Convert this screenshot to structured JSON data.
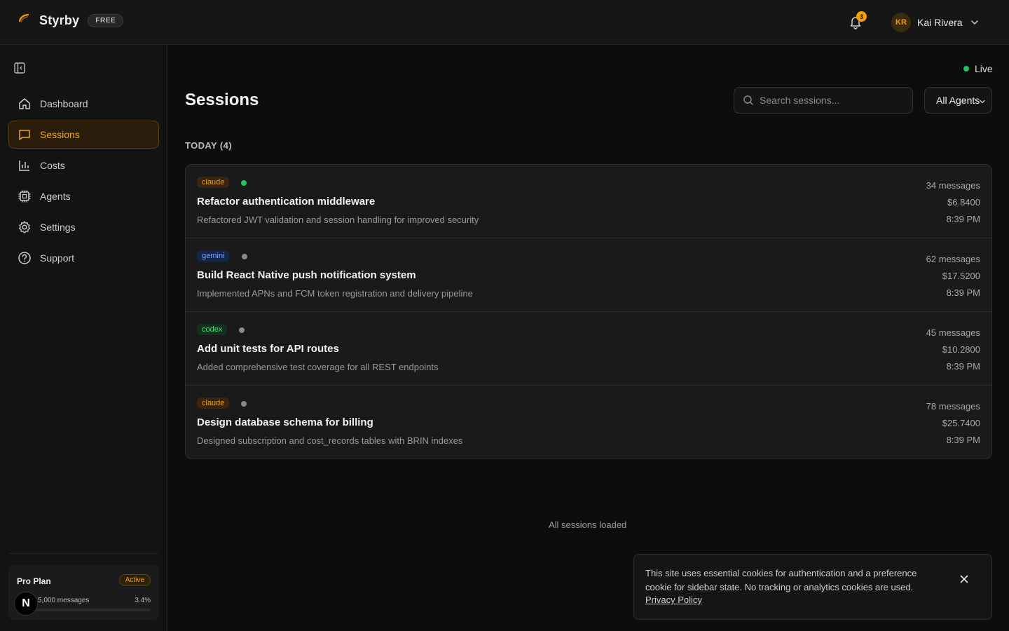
{
  "header": {
    "brand": "Styrby",
    "plan_badge": "FREE",
    "notification_count": "3",
    "user_initials": "KR",
    "user_name": "Kai Rivera"
  },
  "sidebar": {
    "items": [
      {
        "label": "Dashboard",
        "icon": "home-icon"
      },
      {
        "label": "Sessions",
        "icon": "chat-icon"
      },
      {
        "label": "Costs",
        "icon": "bar-chart-icon"
      },
      {
        "label": "Agents",
        "icon": "cpu-icon"
      },
      {
        "label": "Settings",
        "icon": "gear-icon"
      },
      {
        "label": "Support",
        "icon": "help-icon"
      }
    ],
    "active": "Sessions",
    "plan": {
      "name": "Pro Plan",
      "status": "Active",
      "usage": "5,000 messages",
      "usage_pct": "3.4%",
      "usage_fraction": 0.034
    },
    "n_badge": "N"
  },
  "main": {
    "live_label": "Live",
    "title": "Sessions",
    "search_placeholder": "Search sessions...",
    "agent_filter": "All Agents",
    "group_label": "TODAY (4)",
    "sessions": [
      {
        "agent": "claude",
        "live": true,
        "title": "Refactor authentication middleware",
        "description": "Refactored JWT validation and session handling for improved security",
        "messages": "34 messages",
        "cost": "$6.8400",
        "time": "8:39 PM"
      },
      {
        "agent": "gemini",
        "live": false,
        "title": "Build React Native push notification system",
        "description": "Implemented APNs and FCM token registration and delivery pipeline",
        "messages": "62 messages",
        "cost": "$17.5200",
        "time": "8:39 PM"
      },
      {
        "agent": "codex",
        "live": false,
        "title": "Add unit tests for API routes",
        "description": "Added comprehensive test coverage for all REST endpoints",
        "messages": "45 messages",
        "cost": "$10.2800",
        "time": "8:39 PM"
      },
      {
        "agent": "claude",
        "live": false,
        "title": "Design database schema for billing",
        "description": "Designed subscription and cost_records tables with BRIN indexes",
        "messages": "78 messages",
        "cost": "$25.7400",
        "time": "8:39 PM"
      }
    ],
    "footer": "All sessions loaded"
  },
  "cookie_banner": {
    "text": "This site uses essential cookies for authentication and a preference cookie for sidebar state. No tracking or analytics cookies are used.",
    "link": "Privacy Policy"
  },
  "colors": {
    "accent": "#f59e0b",
    "live": "#22c55e",
    "background": "#0d0d0d"
  }
}
